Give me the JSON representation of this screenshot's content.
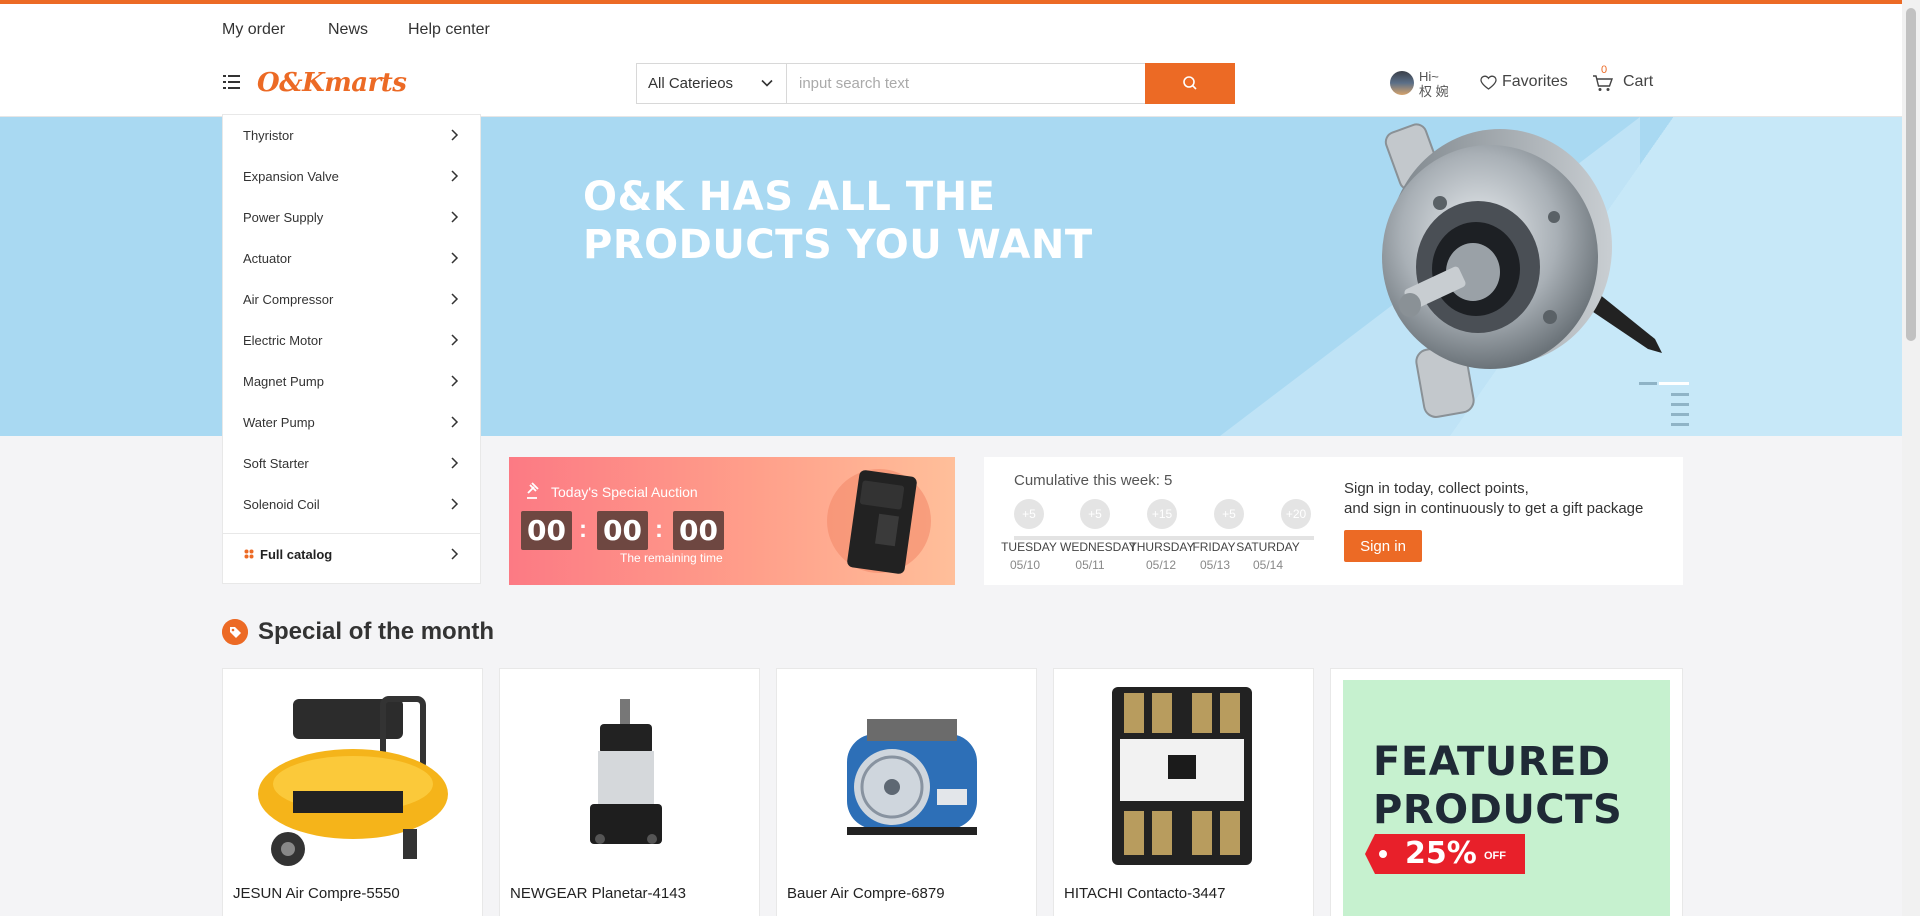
{
  "topnav": {
    "links": [
      "My order",
      "News",
      "Help center"
    ]
  },
  "header": {
    "logo": "O&Kmarts",
    "search": {
      "category": "All Caterieos",
      "placeholder": "input search text"
    },
    "user": {
      "greeting": "Hi~",
      "name": "权 婉"
    },
    "favorites": "Favorites",
    "cart": {
      "label": "Cart",
      "count": "0"
    }
  },
  "banner": {
    "headline_line1": "O&K HAS ALL THE",
    "headline_line2": "PRODUCTS YOU WANT"
  },
  "sidebar": {
    "items": [
      "Thyristor",
      "Expansion Valve",
      "Power Supply",
      "Actuator",
      "Air Compressor",
      "Electric Motor",
      "Magnet Pump",
      "Water Pump",
      "Soft Starter",
      "Solenoid Coil"
    ],
    "catalog": "Full catalog"
  },
  "auction": {
    "title": "Today's Special Auction",
    "hours": "00",
    "minutes": "00",
    "seconds": "00",
    "caption": "The remaining time"
  },
  "checkin": {
    "cumulative": "Cumulative this week: 5",
    "days": [
      {
        "points": "+5",
        "day": "TUESDAY",
        "date": "05/10"
      },
      {
        "points": "+5",
        "day": "WEDNESDAY",
        "date": "05/11"
      },
      {
        "points": "+15",
        "day": "THURSDAY",
        "date": "05/12"
      },
      {
        "points": "+5",
        "day": "FRIDAY",
        "date": "05/13"
      },
      {
        "points": "+20",
        "day": "SATURDAY",
        "date": "05/14"
      }
    ],
    "message_line1": "Sign in today, collect points,",
    "message_line2": "and sign in continuously to get a gift package",
    "button": "Sign in"
  },
  "special": {
    "title": "Special of the month",
    "products": [
      "JESUN Air Compre-5550",
      "NEWGEAR Planetar-4143",
      "Bauer Air Compre-6879",
      "HITACHI Contacto-3447"
    ],
    "featured": {
      "line1": "FEATURED",
      "line2": "PRODUCTS",
      "discount": "25%",
      "off": "OFF"
    }
  },
  "colors": {
    "accent": "#ec6a25",
    "banner_bg": "#a9d9f2"
  }
}
